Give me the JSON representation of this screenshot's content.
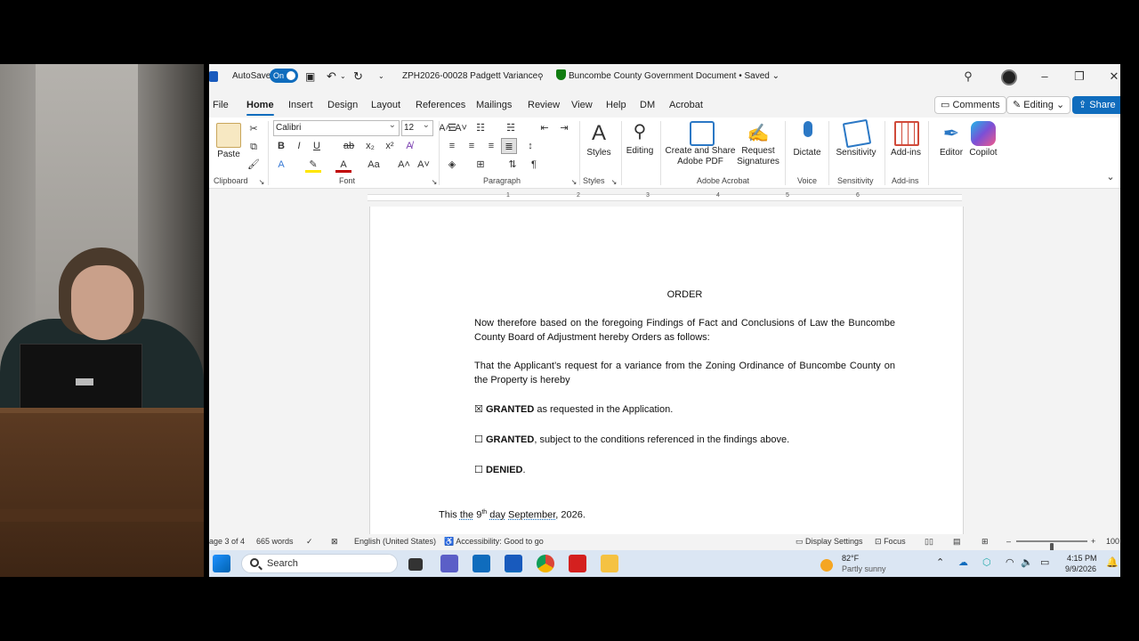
{
  "titlebar": {
    "autosave_label": "AutoSave",
    "autosave_state": "On",
    "document_name": "ZPH2026-00028 Padgett Variance",
    "sensitivity_doc": "Buncombe County Government Document • Saved",
    "save_chevron": "⌄"
  },
  "menu": {
    "tabs": [
      "File",
      "Home",
      "Insert",
      "Design",
      "Layout",
      "References",
      "Mailings",
      "Review",
      "View",
      "Help",
      "DM",
      "Acrobat"
    ],
    "comments": "Comments",
    "editing": "Editing",
    "share": "Share"
  },
  "ribbon": {
    "paste": "Paste",
    "clipboard": "Clipboard",
    "font_name": "Calibri",
    "font_size": "12",
    "font": "Font",
    "paragraph": "Paragraph",
    "styles": "Styles",
    "styles_group": "Styles",
    "editing": "Editing",
    "create_share_pdf_1": "Create and Share",
    "create_share_pdf_2": "Adobe PDF",
    "request_sig_1": "Request",
    "request_sig_2": "Signatures",
    "adobe_acrobat": "Adobe Acrobat",
    "dictate": "Dictate",
    "voice": "Voice",
    "sensitivity": "Sensitivity",
    "sensitivity_group": "Sensitivity",
    "addins": "Add-ins",
    "addins_group": "Add-ins",
    "editor": "Editor",
    "copilot": "Copilot"
  },
  "ruler": {
    "marks": [
      "1",
      "2",
      "3",
      "4",
      "5",
      "6"
    ]
  },
  "document": {
    "heading": "ORDER",
    "p1": "Now therefore based on the foregoing Findings of Fact and Conclusions of Law the Buncombe County Board of Adjustment hereby Orders as follows:",
    "p2": "That the Applicant’s request for a variance from the Zoning Ordinance of Buncombe County on the Property is hereby",
    "opt1_box": "☒",
    "opt1_bold": "GRANTED",
    "opt1_rest": " as requested in the Application.",
    "opt2_box": "☐",
    "opt2_bold": "GRANTED",
    "opt2_rest": ", subject to the conditions referenced in the findings above.",
    "opt3_box": "☐",
    "opt3_bold": "DENIED",
    "opt3_rest": ".",
    "date_pre": "This ",
    "date_the": "the",
    "date_num": " 9",
    "date_sup": "th",
    "date_day": "day",
    "date_month": "September,",
    "date_year": " 2026."
  },
  "status": {
    "page": "age 3 of 4",
    "words": "665 words",
    "language": "English (United States)",
    "accessibility": "Accessibility: Good to go",
    "display_settings": "Display Settings",
    "focus": "Focus",
    "zoom_minus": "–",
    "zoom_plus": "+",
    "zoom": "100",
    "zoom_level": 0.5
  },
  "taskbar": {
    "search": "Search",
    "weather_temp": "82°F",
    "weather_desc": "Partly sunny",
    "time": "4:15 PM",
    "date": "9/9/2026"
  },
  "colors": {
    "accent": "#0f6cbd",
    "taskbar": "#dbe6f3"
  }
}
